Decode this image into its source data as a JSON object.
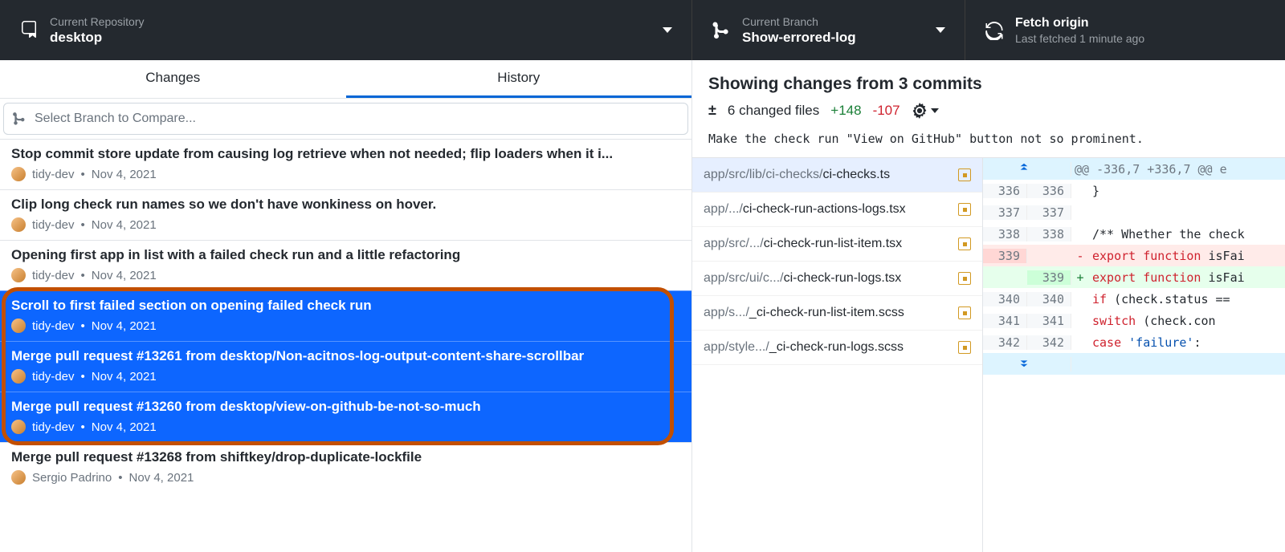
{
  "toolbar": {
    "repo_label": "Current Repository",
    "repo_value": "desktop",
    "branch_label": "Current Branch",
    "branch_value": "Show-errored-log",
    "fetch_label": "Fetch origin",
    "fetch_sub": "Last fetched 1 minute ago"
  },
  "tabs": {
    "changes": "Changes",
    "history": "History"
  },
  "branch_compare_placeholder": "Select Branch to Compare...",
  "commits": [
    {
      "title": "Stop commit store update from causing log retrieve when not needed; flip loaders when it i...",
      "author": "tidy-dev",
      "date": "Nov 4, 2021",
      "selected": false
    },
    {
      "title": "Clip long check run names so we don't have wonkiness on hover.",
      "author": "tidy-dev",
      "date": "Nov 4, 2021",
      "selected": false
    },
    {
      "title": "Opening first app in list with a failed check run and a little refactoring",
      "author": "tidy-dev",
      "date": "Nov 4, 2021",
      "selected": false
    },
    {
      "title": "Scroll to first failed section on opening failed check run",
      "author": "tidy-dev",
      "date": "Nov 4, 2021",
      "selected": true
    },
    {
      "title": "Merge pull request #13261 from desktop/Non-acitnos-log-output-content-share-scrollbar",
      "author": "tidy-dev",
      "date": "Nov 4, 2021",
      "selected": true
    },
    {
      "title": "Merge pull request #13260 from desktop/view-on-github-be-not-so-much",
      "author": "tidy-dev",
      "date": "Nov 4, 2021",
      "selected": true
    },
    {
      "title": "Merge pull request #13268 from shiftkey/drop-duplicate-lockfile",
      "author": "Sergio Padrino",
      "date": "Nov 4, 2021",
      "selected": false
    }
  ],
  "changes": {
    "title": "Showing changes from 3 commits",
    "files_count": "6 changed files",
    "additions": "+148",
    "deletions": "-107"
  },
  "commit_message": "Make the check run \"View on GitHub\" button not so prominent.",
  "files": [
    {
      "prefix": "app/src/lib/ci-checks/",
      "name": "ci-checks.ts",
      "active": true
    },
    {
      "prefix": "app/.../",
      "name": "ci-check-run-actions-logs.tsx",
      "active": false
    },
    {
      "prefix": "app/src/.../",
      "name": "ci-check-run-list-item.tsx",
      "active": false
    },
    {
      "prefix": "app/src/ui/c.../",
      "name": "ci-check-run-logs.tsx",
      "active": false
    },
    {
      "prefix": "app/s.../",
      "name": "_ci-check-run-list-item.scss",
      "active": false
    },
    {
      "prefix": "app/style.../",
      "name": "_ci-check-run-logs.scss",
      "active": false
    }
  ],
  "diff": {
    "hunk": "@@ -336,7 +336,7 @@ e",
    "rows": [
      {
        "type": "ctx",
        "old": "336",
        "new": "336",
        "code": "  }"
      },
      {
        "type": "ctx",
        "old": "337",
        "new": "337",
        "code": ""
      },
      {
        "type": "ctx",
        "old": "338",
        "new": "338",
        "code": "  /** Whether the check"
      },
      {
        "type": "del",
        "old": "339",
        "new": "",
        "code": "export function isFai"
      },
      {
        "type": "add",
        "old": "",
        "new": "339",
        "code": "export function isFai"
      },
      {
        "type": "ctx",
        "old": "340",
        "new": "340",
        "code": "    if (check.status =="
      },
      {
        "type": "ctx",
        "old": "341",
        "new": "341",
        "code": "      switch (check.con"
      },
      {
        "type": "ctx",
        "old": "342",
        "new": "342",
        "code": "        case 'failure':"
      }
    ]
  }
}
